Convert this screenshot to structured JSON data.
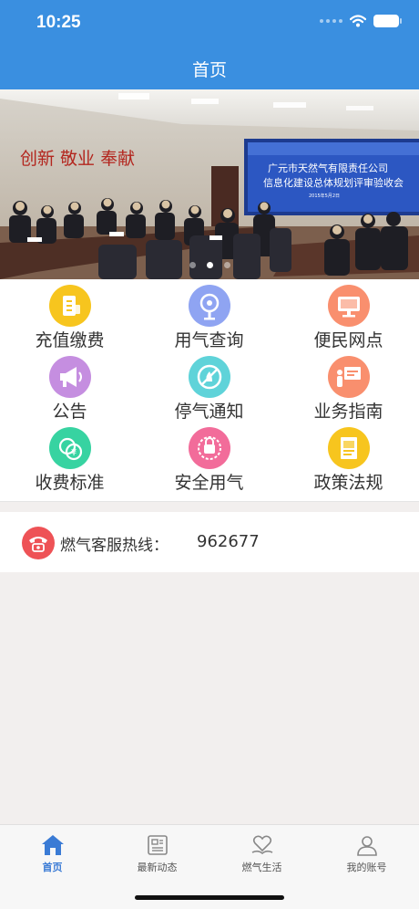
{
  "status": {
    "time": "10:25"
  },
  "nav": {
    "title": "首页"
  },
  "banner": {
    "wall_slogan": "创新 敬业 奉献",
    "screen_line1": "广元市天然气有限责任公司",
    "screen_line2": "信息化建设总体规划评审验收会",
    "screen_date": "2015年5月2日",
    "page_count": 3,
    "active_page": 2
  },
  "grid": {
    "items": [
      {
        "label": "充值缴费",
        "icon": "wallet-icon",
        "color": "#f7c51e"
      },
      {
        "label": "用气查询",
        "icon": "search-gas-icon",
        "color": "#8fa4f2"
      },
      {
        "label": "便民网点",
        "icon": "monitor-icon",
        "color": "#f98f6e"
      },
      {
        "label": "公告",
        "icon": "megaphone-icon",
        "color": "#c58ee0"
      },
      {
        "label": "停气通知",
        "icon": "no-gas-icon",
        "color": "#5fd3d9"
      },
      {
        "label": "业务指南",
        "icon": "guide-board-icon",
        "color": "#f98f6e"
      },
      {
        "label": "收费标准",
        "icon": "coins-icon",
        "color": "#37d3a1"
      },
      {
        "label": "安全用气",
        "icon": "safety-icon",
        "color": "#f26c9a"
      },
      {
        "label": "政策法规",
        "icon": "document-icon",
        "color": "#f7c51e"
      }
    ]
  },
  "hotline": {
    "label": "燃气客服热线：",
    "number": "962677"
  },
  "tabbar": {
    "tabs": [
      {
        "label": "首页",
        "icon": "home-icon",
        "active": true
      },
      {
        "label": "最新动态",
        "icon": "news-icon",
        "active": false
      },
      {
        "label": "燃气生活",
        "icon": "heart-hand-icon",
        "active": false
      },
      {
        "label": "我的账号",
        "icon": "user-icon",
        "active": false
      }
    ]
  },
  "colors": {
    "primary": "#3a8fe0",
    "tab_active": "#3a7bd5",
    "hotline_icon": "#ee5256"
  }
}
